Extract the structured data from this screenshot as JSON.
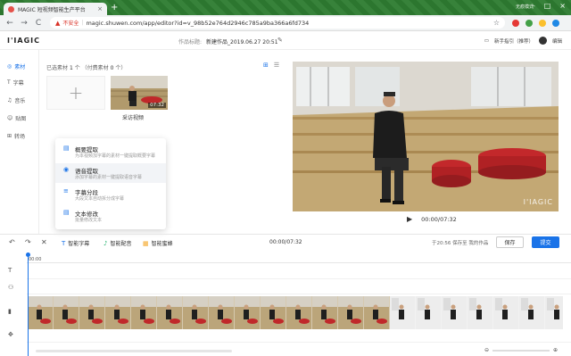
{
  "browser": {
    "tab_title": "MAGIC 短视频智能生产平台",
    "tab_close": "×",
    "new_tab": "+",
    "user_label": "无痕模式",
    "nav_back": "←",
    "nav_forward": "→",
    "nav_reload": "C",
    "insecure_label": "不安全",
    "url": "magic.shuwen.com/app/editor?id=v_98b52e764d2946c785a9ba366a6fd734",
    "win_controls": [
      "–",
      "□",
      "×"
    ],
    "extension_colors": [
      "#e53935",
      "#43a047",
      "#fbc02d",
      "#1e88e5"
    ]
  },
  "header": {
    "logo": "I'IAGIC",
    "project_label": "作品标题:",
    "project_title": "新建作品_2019.06.27 20:51",
    "edit_icon": "✎",
    "right": {
      "guide": "新手指引（推荐）",
      "edit": "编辑"
    }
  },
  "leftnav": {
    "items": [
      {
        "icon": "◎",
        "label": "素材",
        "active": true
      },
      {
        "icon": "T",
        "label": "字幕",
        "active": false
      },
      {
        "icon": "♫",
        "label": "音乐",
        "active": false
      },
      {
        "icon": "☺",
        "label": "贴图",
        "active": false
      },
      {
        "icon": "⊞",
        "label": "转场",
        "active": false
      }
    ]
  },
  "media": {
    "selected_prefix": "已选素材",
    "selected_count": "1",
    "unit": "个",
    "paid_text": "（付费素材",
    "paid_count": "0",
    "paid_suffix": "个）",
    "add_symbol": "+",
    "clip": {
      "duration": "07:32",
      "caption": "采访视频"
    },
    "view_icons": [
      "⊞",
      "☰"
    ]
  },
  "menu": {
    "items": [
      {
        "icon": "▤",
        "title": "概要提取",
        "desc": "为本视频加字幕的素材一键提取概要字幕"
      },
      {
        "icon": "◉",
        "title": "语音提取",
        "desc": "添加字幕的素材一键提取语音字幕"
      },
      {
        "icon": "≡",
        "title": "字幕分段",
        "desc": "大段文本自动拆分成字幕"
      },
      {
        "icon": "▤",
        "title": "文本修改",
        "desc": "批量修改文本"
      }
    ]
  },
  "preview": {
    "watermark": "I'IAGIC",
    "play": "▶",
    "time": "00:00/07:32"
  },
  "toolbar": {
    "undo": "↶",
    "redo": "↷",
    "cut": "✕",
    "tools": [
      {
        "icon": "T",
        "label": "智能字幕"
      },
      {
        "icon": "♪",
        "label": "智能配音"
      },
      {
        "icon": "▦",
        "label": "智能蜜蜂"
      }
    ],
    "timecode": "00:00/07:32",
    "saved_text": "于20:56 保存至 我的作品",
    "save": "保存",
    "submit": "提交"
  },
  "timeline": {
    "ruler_label": "00:00",
    "track_icons": [
      "T",
      "⚇",
      "▮",
      "✥"
    ],
    "zoom_minus": "⊖",
    "zoom_plus": "⊕"
  }
}
